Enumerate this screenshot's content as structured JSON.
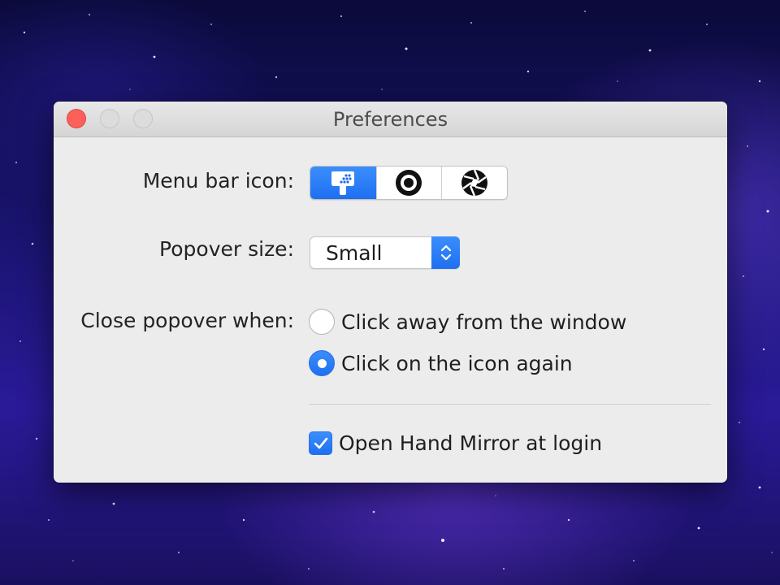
{
  "window": {
    "title": "Preferences"
  },
  "menu_bar_icon": {
    "label": "Menu bar icon:",
    "options": [
      {
        "icon": "hand-mirror-icon",
        "selected": true
      },
      {
        "icon": "ring-icon",
        "selected": false
      },
      {
        "icon": "aperture-icon",
        "selected": false
      }
    ]
  },
  "popover_size": {
    "label": "Popover size:",
    "value": "Small"
  },
  "close_popover": {
    "label": "Close popover when:",
    "options": [
      {
        "label": "Click away from the window",
        "selected": false
      },
      {
        "label": "Click on the icon again",
        "selected": true
      }
    ]
  },
  "login": {
    "label": "Open Hand Mirror at login",
    "checked": true
  },
  "colors": {
    "accent": "#1f6ff0",
    "close": "#fc605b"
  }
}
